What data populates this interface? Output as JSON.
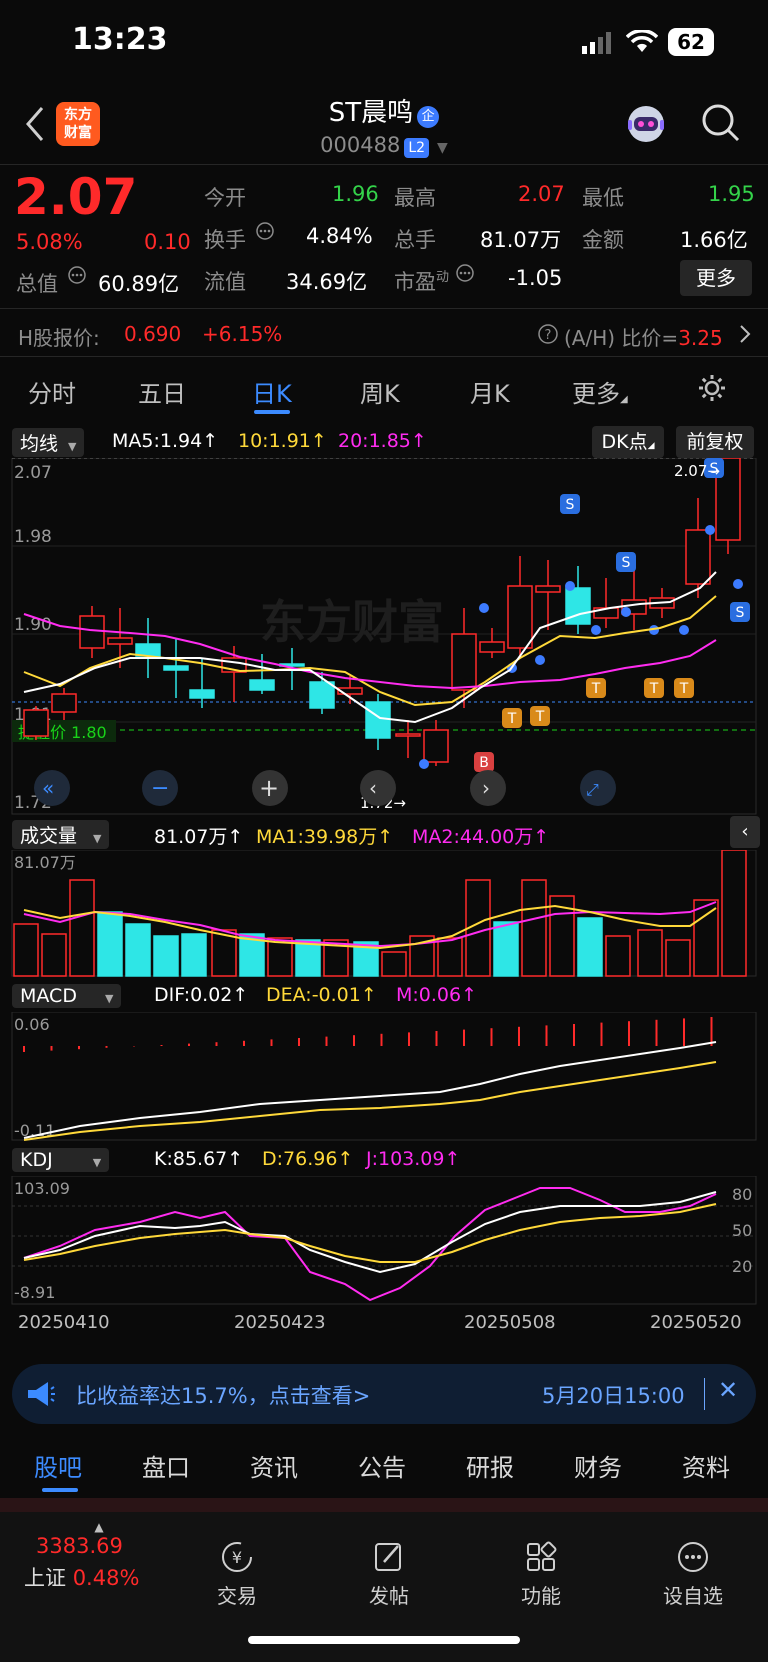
{
  "status": {
    "time": "13:23",
    "battery": "62"
  },
  "header": {
    "brand_line1": "东方",
    "brand_line2": "财富",
    "stock_name": "ST晨鸣",
    "enterprise_badge": "企",
    "code": "000488",
    "level_badge": "L2"
  },
  "quote": {
    "price": "2.07",
    "pct": "5.08%",
    "change": "0.10",
    "open_label": "今开",
    "open": "1.96",
    "high_label": "最高",
    "high": "2.07",
    "low_label": "最低",
    "low": "1.95",
    "turnover_label": "换手",
    "turnover": "4.84%",
    "volume_label": "总手",
    "volume": "81.07万",
    "amount_label": "金额",
    "amount": "1.66亿",
    "mktcap_label": "总值",
    "mktcap": "60.89亿",
    "float_label": "流值",
    "float": "34.69亿",
    "pe_label": "市盈",
    "pe_sup": "动",
    "pe": "-1.05",
    "more": "更多"
  },
  "hshare": {
    "label": "H股报价:",
    "price": "0.690",
    "pct": "+6.15%",
    "ah_label": "(A/H) 比价=",
    "ah_value": "3.25"
  },
  "tabs": [
    "分时",
    "五日",
    "日K",
    "周K",
    "月K",
    "更多"
  ],
  "kline": {
    "ma_selector": "均线",
    "ma5": "MA5:1.94",
    "ma10": "10:1.91",
    "ma20": "20:1.85",
    "dk_button": "DK点",
    "adjust_button": "前复权",
    "price_axis": [
      "2.07",
      "1.98",
      "1.90",
      "1.81",
      "1.72"
    ],
    "alert_label": "提醒价 1.80",
    "max_label": "2.07",
    "min_label": "1.72",
    "watermark": "东方财富"
  },
  "volume": {
    "selector": "成交量",
    "val": "81.07万",
    "ma1": "MA1:39.98万",
    "ma2": "MA2:44.00万",
    "axis_top": "81.07万"
  },
  "macd": {
    "selector": "MACD",
    "dif": "DIF:0.02",
    "dea": "DEA:-0.01",
    "m": "M:0.06",
    "axis_top": "0.06",
    "axis_bottom": "-0.11"
  },
  "kdj": {
    "selector": "KDJ",
    "k": "K:85.67",
    "d": "D:76.96",
    "j": "J:103.09",
    "axis_top": "103.09",
    "axis_bottom": "-8.91",
    "levels": [
      "80",
      "50",
      "20"
    ]
  },
  "dates": [
    "20250410",
    "20250423",
    "20250508",
    "20250520"
  ],
  "banner": {
    "text": "比收益率达15.7%，点击查看>",
    "time": "5月20日15:00"
  },
  "bottom_tabs": [
    "股吧",
    "盘口",
    "资讯",
    "公告",
    "研报",
    "财务",
    "资料"
  ],
  "dock": {
    "index_value": "3383.69",
    "index_name": "上证",
    "index_pct": "0.48%",
    "items": [
      "交易",
      "发帖",
      "功能",
      "设自选"
    ]
  },
  "colors": {
    "up": "#ff2a2a",
    "down": "#2ee6e6",
    "accent": "#3c8bff"
  }
}
